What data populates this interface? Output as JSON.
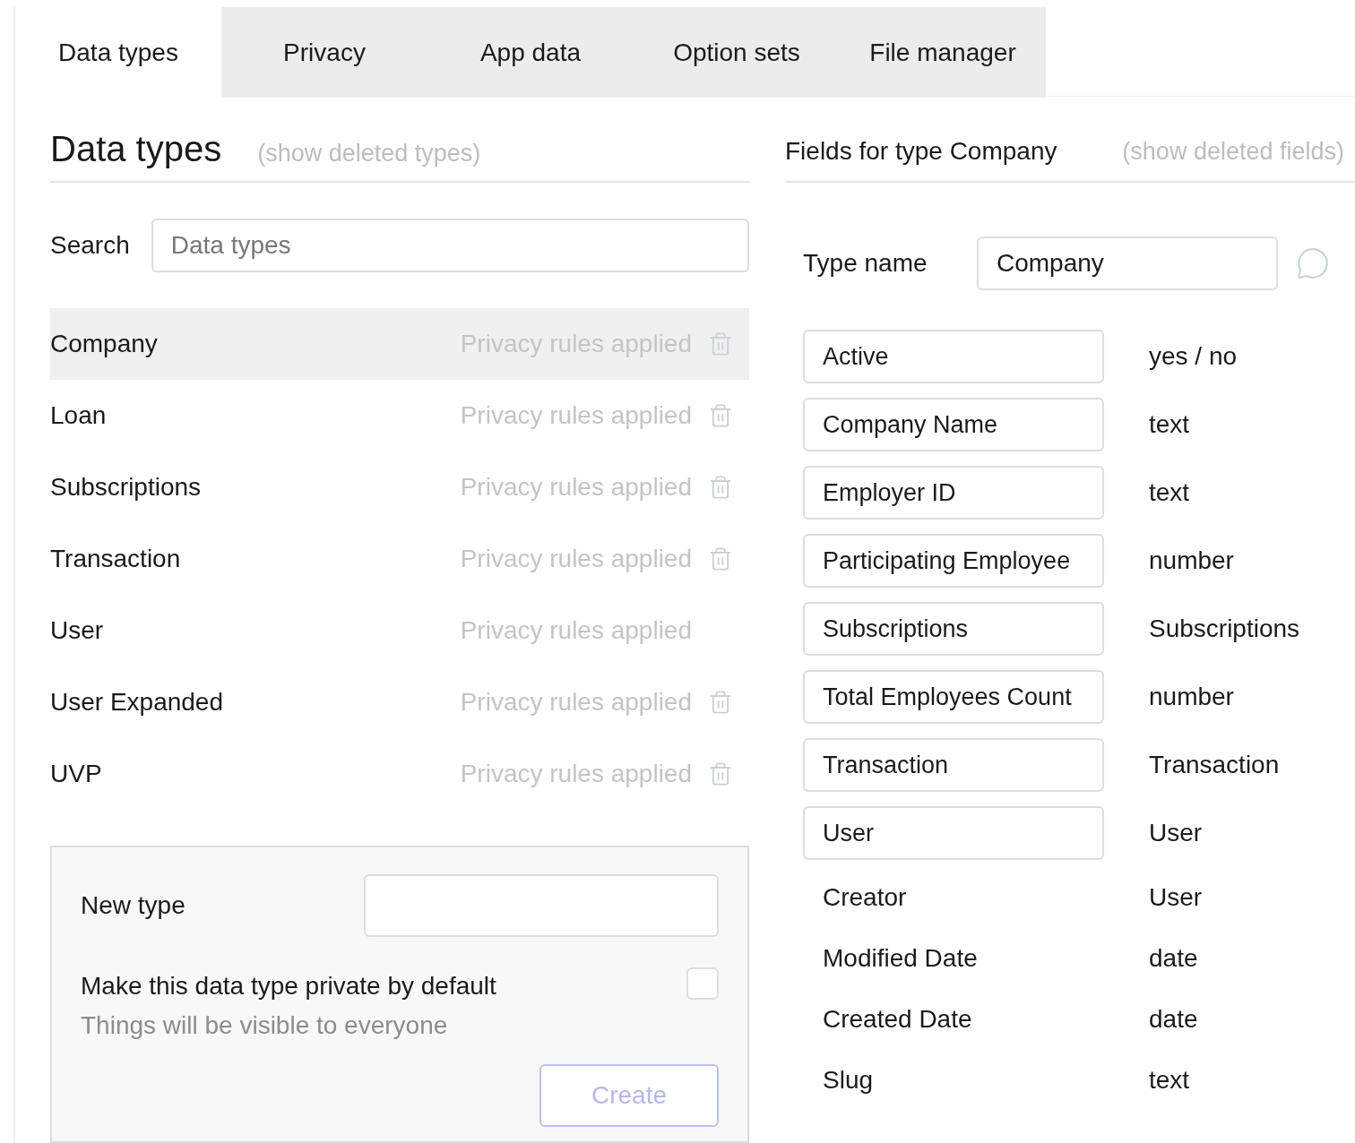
{
  "tabs": [
    {
      "label": "Data types",
      "selected": true
    },
    {
      "label": "Privacy",
      "selected": false
    },
    {
      "label": "App data",
      "selected": false
    },
    {
      "label": "Option sets",
      "selected": false
    },
    {
      "label": "File manager",
      "selected": false
    }
  ],
  "data_types": {
    "title": "Data types",
    "show_deleted_link": "(show deleted types)",
    "search": {
      "label": "Search",
      "placeholder": "Data types"
    },
    "items": [
      {
        "name": "Company",
        "status": "Privacy rules applied",
        "deletable": true,
        "selected": true
      },
      {
        "name": "Loan",
        "status": "Privacy rules applied",
        "deletable": true,
        "selected": false
      },
      {
        "name": "Subscriptions",
        "status": "Privacy rules applied",
        "deletable": true,
        "selected": false
      },
      {
        "name": "Transaction",
        "status": "Privacy rules applied",
        "deletable": true,
        "selected": false
      },
      {
        "name": "User",
        "status": "Privacy rules applied",
        "deletable": false,
        "selected": false
      },
      {
        "name": "User Expanded",
        "status": "Privacy rules applied",
        "deletable": true,
        "selected": false
      },
      {
        "name": "UVP",
        "status": "Privacy rules applied",
        "deletable": true,
        "selected": false
      }
    ],
    "new_type": {
      "label": "New type",
      "private_label": "Make this data type private by default",
      "private_checked": false,
      "hint": "Things will be visible to everyone",
      "create_button": {
        "label": "Create",
        "disabled": true
      }
    }
  },
  "fields_panel": {
    "title": "Fields for type Company",
    "show_deleted_link": "(show deleted fields)",
    "type_name": {
      "label": "Type name",
      "value": "Company"
    },
    "fields": [
      {
        "kind": "custom",
        "name": "Active",
        "type": "yes / no"
      },
      {
        "kind": "custom",
        "name": "Company Name",
        "type": "text"
      },
      {
        "kind": "custom",
        "name": "Employer ID",
        "type": "text"
      },
      {
        "kind": "custom",
        "name": "Participating Employee",
        "type": "number"
      },
      {
        "kind": "custom",
        "name": "Subscriptions",
        "type": "Subscriptions"
      },
      {
        "kind": "custom",
        "name": "Total Employees Count",
        "type": "number"
      },
      {
        "kind": "custom",
        "name": "Transaction",
        "type": "Transaction"
      },
      {
        "kind": "custom",
        "name": "User",
        "type": "User"
      },
      {
        "kind": "builtin",
        "name": "Creator",
        "type": "User"
      },
      {
        "kind": "builtin",
        "name": "Modified Date",
        "type": "date"
      },
      {
        "kind": "builtin",
        "name": "Created Date",
        "type": "date"
      },
      {
        "kind": "builtin",
        "name": "Slug",
        "type": "text"
      }
    ]
  }
}
